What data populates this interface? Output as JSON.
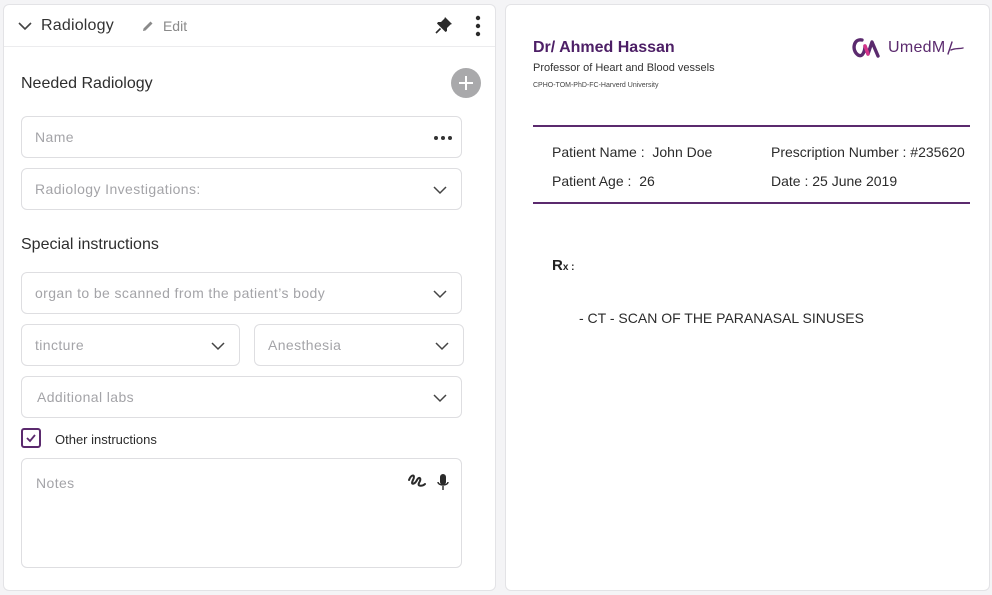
{
  "form": {
    "header_title": "Radiology",
    "edit_label": "Edit",
    "needed_title": "Needed Radiology",
    "name_placeholder": "Name",
    "investigations_placeholder": "Radiology Investigations:",
    "special_title": "Special instructions",
    "organ_placeholder": "organ to be scanned from the patient’s body",
    "tincture_placeholder": "tincture",
    "anesthesia_placeholder": "Anesthesia",
    "labs_placeholder": "Additional labs",
    "other_instructions_label": "Other instructions",
    "other_instructions_checked": true,
    "notes_placeholder": "Notes"
  },
  "prescription": {
    "doctor_name": "Dr/ Ahmed Hassan",
    "doctor_title": "Professor of Heart and Blood vessels",
    "doctor_credentials": "CPHO-TOM-PhD-FC-Harverd University",
    "logo_text": "UmedM",
    "patient_name_label": "Patient Name :",
    "patient_name": "John Doe",
    "patient_age_label": "Patient Age :",
    "patient_age": "26",
    "prescription_number_label": "Prescription Number :",
    "prescription_number": "#235620",
    "date_label": "Date :",
    "date": "25 June 2019",
    "rx_label": "R",
    "rx_sub": "x",
    "rx_colon": " :",
    "rx_item": "-  CT - SCAN OF THE PARANASAL SINUSES"
  },
  "colors": {
    "accent": "#5b2a6e",
    "accent_dark": "#4d1f66",
    "logo_pink": "#d6338a"
  }
}
